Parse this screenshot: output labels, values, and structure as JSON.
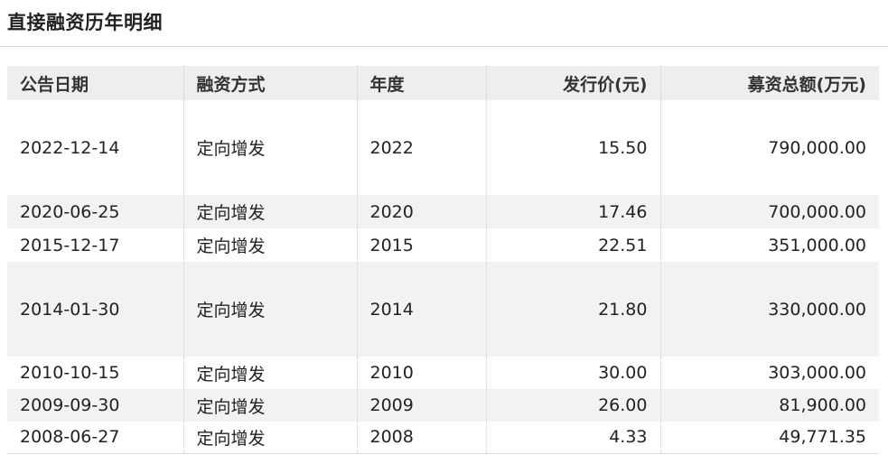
{
  "section": {
    "title": "直接融资历年明细"
  },
  "table": {
    "headers": [
      "公告日期",
      "融资方式",
      "年度",
      "发行价(元)",
      "募资总额(万元)"
    ],
    "rows": [
      [
        "2022-12-14",
        "定向增发",
        "2022",
        "15.50",
        "790,000.00"
      ],
      [
        "2020-06-25",
        "定向增发",
        "2020",
        "17.46",
        "700,000.00"
      ],
      [
        "2015-12-17",
        "定向增发",
        "2015",
        "22.51",
        "351,000.00"
      ],
      [
        "2014-01-30",
        "定向增发",
        "2014",
        "21.80",
        "330,000.00"
      ],
      [
        "2010-10-15",
        "定向增发",
        "2010",
        "30.00",
        "303,000.00"
      ],
      [
        "2009-09-30",
        "定向增发",
        "2009",
        "26.00",
        "81,900.00"
      ],
      [
        "2008-06-27",
        "定向增发",
        "2008",
        "4.33",
        "49,771.35"
      ]
    ]
  },
  "colors": {
    "header_bg": "#eeeeee",
    "stripe_bg": "#f2f2f2",
    "text": "#222222",
    "rule": "#dcdcdc"
  }
}
